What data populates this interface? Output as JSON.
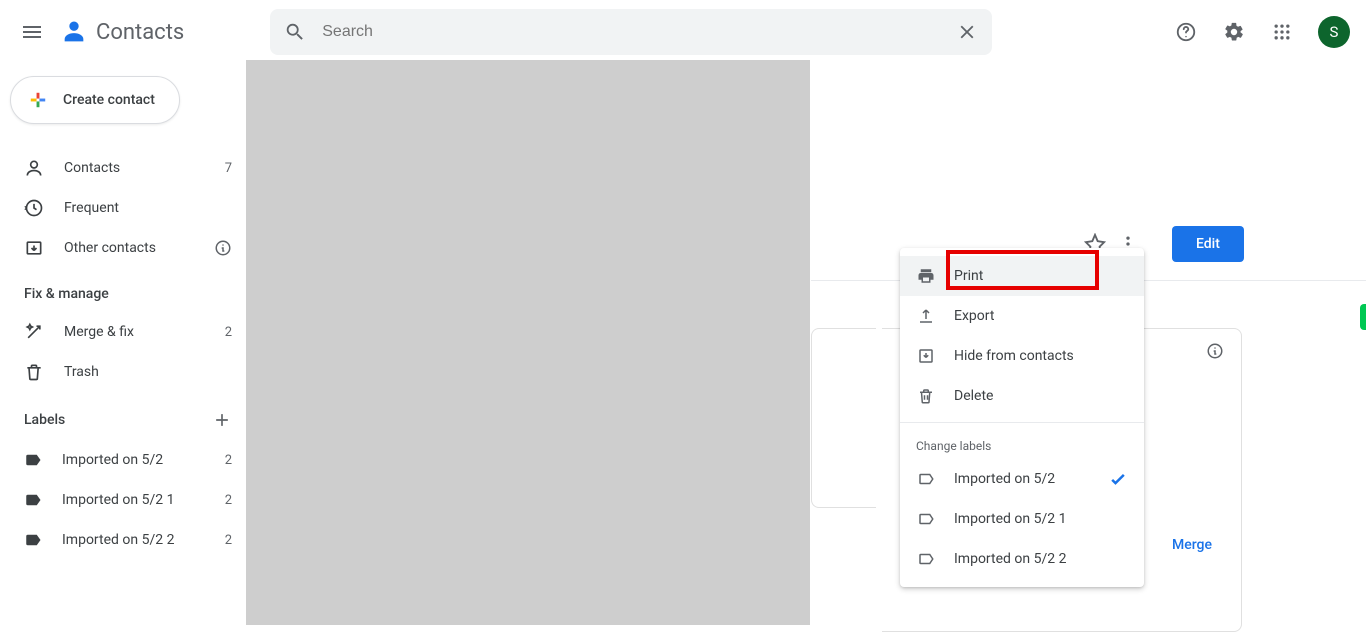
{
  "header": {
    "app_title": "Contacts",
    "search_placeholder": "Search",
    "avatar_initial": "S"
  },
  "sidebar": {
    "create_label": "Create contact",
    "nav": [
      {
        "icon": "person",
        "label": "Contacts",
        "count": "7"
      },
      {
        "icon": "history",
        "label": "Frequent",
        "count": ""
      },
      {
        "icon": "archive",
        "label": "Other contacts",
        "info": true
      }
    ],
    "fix_heading": "Fix & manage",
    "fix_items": [
      {
        "icon": "wand",
        "label": "Merge & fix",
        "count": "2"
      },
      {
        "icon": "trash",
        "label": "Trash",
        "count": ""
      }
    ],
    "labels_heading": "Labels",
    "labels": [
      {
        "label": "Imported on 5/2",
        "count": "2"
      },
      {
        "label": "Imported on 5/2 1",
        "count": "2"
      },
      {
        "label": "Imported on 5/2 2",
        "count": "2"
      }
    ]
  },
  "contact_toolbar": {
    "edit_label": "Edit"
  },
  "merge_label": "Merge",
  "menu": {
    "items": [
      {
        "icon": "print",
        "label": "Print",
        "hover": true
      },
      {
        "icon": "export",
        "label": "Export"
      },
      {
        "icon": "hide",
        "label": "Hide from contacts"
      },
      {
        "icon": "delete",
        "label": "Delete"
      }
    ],
    "labels_heading": "Change labels",
    "labels": [
      {
        "label": "Imported on 5/2",
        "check": true
      },
      {
        "label": "Imported on 5/2 1",
        "check": false
      },
      {
        "label": "Imported on 5/2 2",
        "check": false
      }
    ]
  }
}
